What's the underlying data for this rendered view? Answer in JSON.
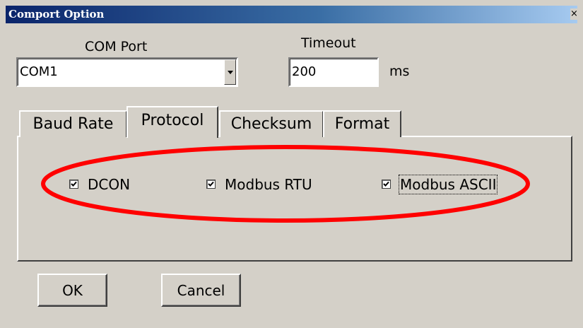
{
  "window": {
    "title": "Comport Option",
    "close_glyph": "×"
  },
  "com_port": {
    "label": "COM Port",
    "value": "COM1"
  },
  "timeout": {
    "label": "Timeout",
    "value": "200",
    "unit": "ms"
  },
  "tabs": [
    {
      "label": "Baud Rate",
      "selected": false
    },
    {
      "label": "Protocol",
      "selected": true
    },
    {
      "label": "Checksum",
      "selected": false
    },
    {
      "label": "Format",
      "selected": false
    }
  ],
  "protocols": [
    {
      "label": "DCON",
      "checked": true
    },
    {
      "label": "Modbus RTU",
      "checked": true
    },
    {
      "label": "Modbus ASCII",
      "checked": true
    }
  ],
  "buttons": {
    "ok": "OK",
    "cancel": "Cancel"
  },
  "colors": {
    "window_bg": "#d4d0c8",
    "highlight": "#ff0000",
    "title_start": "#0a246a"
  }
}
